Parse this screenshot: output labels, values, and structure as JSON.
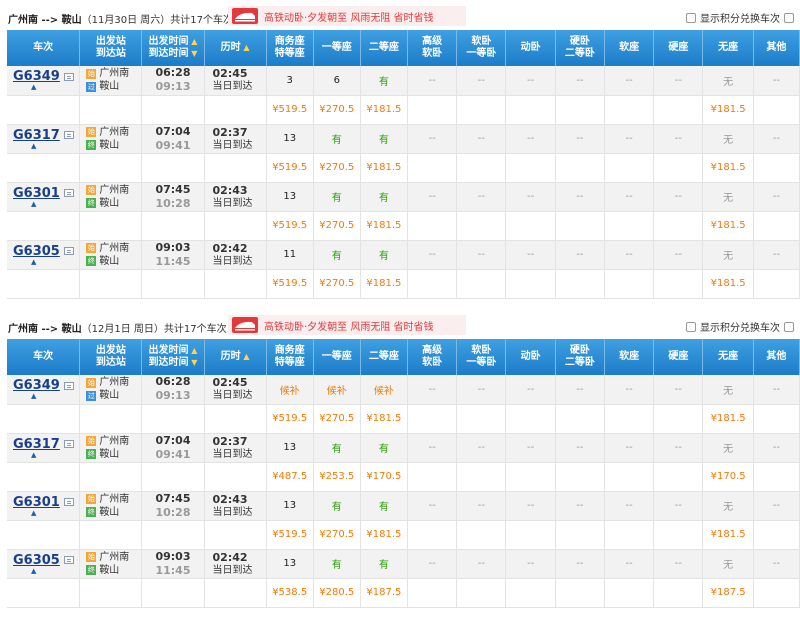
{
  "options_label": "显示积分兑换车次",
  "banner_text": "高铁动卧·夕发朝至 风雨无阻 省时省钱",
  "headers": [
    "车次",
    "出发站\n到达站",
    "出发时间\n到达时间",
    "历时",
    "商务座\n特等座",
    "一等座",
    "二等座",
    "高级\n软卧",
    "软卧\n一等卧",
    "动卧",
    "硬卧\n二等卧",
    "软座",
    "硬座",
    "无座",
    "其他"
  ],
  "colors": {
    "header_blue": "#1c7cc8",
    "price_orange": "#f07b0a",
    "available_green": "#26a306",
    "train_no_blue": "#1a3f8a",
    "banner_red": "#e4393c"
  },
  "sections": [
    {
      "route": "广州南 --> 鞍山",
      "date_text": "（11月30日 周六）",
      "count_text": "共计17个车次",
      "trains": [
        {
          "no": "G6349",
          "from": "广州南",
          "to": "鞍山",
          "from_badge": "始",
          "to_badge": "过",
          "dep": "06:28",
          "arr": "09:13",
          "dur": "02:45",
          "day": "当日到达",
          "seats": [
            "3",
            "6",
            "有",
            "--",
            "--",
            "--",
            "--",
            "--",
            "--",
            "无",
            "--"
          ],
          "prices": [
            "¥519.5",
            "¥270.5",
            "¥181.5",
            "",
            "",
            "",
            "",
            "",
            "",
            "¥181.5",
            ""
          ]
        },
        {
          "no": "G6317",
          "from": "广州南",
          "to": "鞍山",
          "from_badge": "始",
          "to_badge": "终",
          "dep": "07:04",
          "arr": "09:41",
          "dur": "02:37",
          "day": "当日到达",
          "seats": [
            "13",
            "有",
            "有",
            "--",
            "--",
            "--",
            "--",
            "--",
            "--",
            "无",
            "--"
          ],
          "prices": [
            "¥519.5",
            "¥270.5",
            "¥181.5",
            "",
            "",
            "",
            "",
            "",
            "",
            "¥181.5",
            ""
          ]
        },
        {
          "no": "G6301",
          "from": "广州南",
          "to": "鞍山",
          "from_badge": "始",
          "to_badge": "终",
          "dep": "07:45",
          "arr": "10:28",
          "dur": "02:43",
          "day": "当日到达",
          "seats": [
            "13",
            "有",
            "有",
            "--",
            "--",
            "--",
            "--",
            "--",
            "--",
            "无",
            "--"
          ],
          "prices": [
            "¥519.5",
            "¥270.5",
            "¥181.5",
            "",
            "",
            "",
            "",
            "",
            "",
            "¥181.5",
            ""
          ]
        },
        {
          "no": "G6305",
          "from": "广州南",
          "to": "鞍山",
          "from_badge": "始",
          "to_badge": "终",
          "dep": "09:03",
          "arr": "11:45",
          "dur": "02:42",
          "day": "当日到达",
          "seats": [
            "11",
            "有",
            "有",
            "--",
            "--",
            "--",
            "--",
            "--",
            "--",
            "无",
            "--"
          ],
          "prices": [
            "¥519.5",
            "¥270.5",
            "¥181.5",
            "",
            "",
            "",
            "",
            "",
            "",
            "¥181.5",
            ""
          ]
        }
      ]
    },
    {
      "route": "广州南 --> 鞍山",
      "date_text": "（12月1日 周日）",
      "count_text": "共计17个车次",
      "trains": [
        {
          "no": "G6349",
          "from": "广州南",
          "to": "鞍山",
          "from_badge": "始",
          "to_badge": "过",
          "dep": "06:28",
          "arr": "09:13",
          "dur": "02:45",
          "day": "当日到达",
          "seats": [
            "候补",
            "候补",
            "候补",
            "--",
            "--",
            "--",
            "--",
            "--",
            "--",
            "无",
            "--"
          ],
          "prices": [
            "¥519.5",
            "¥270.5",
            "¥181.5",
            "",
            "",
            "",
            "",
            "",
            "",
            "¥181.5",
            ""
          ]
        },
        {
          "no": "G6317",
          "from": "广州南",
          "to": "鞍山",
          "from_badge": "始",
          "to_badge": "终",
          "dep": "07:04",
          "arr": "09:41",
          "dur": "02:37",
          "day": "当日到达",
          "seats": [
            "13",
            "有",
            "有",
            "--",
            "--",
            "--",
            "--",
            "--",
            "--",
            "无",
            "--"
          ],
          "prices": [
            "¥487.5",
            "¥253.5",
            "¥170.5",
            "",
            "",
            "",
            "",
            "",
            "",
            "¥170.5",
            ""
          ]
        },
        {
          "no": "G6301",
          "from": "广州南",
          "to": "鞍山",
          "from_badge": "始",
          "to_badge": "终",
          "dep": "07:45",
          "arr": "10:28",
          "dur": "02:43",
          "day": "当日到达",
          "seats": [
            "13",
            "有",
            "有",
            "--",
            "--",
            "--",
            "--",
            "--",
            "--",
            "无",
            "--"
          ],
          "prices": [
            "¥519.5",
            "¥270.5",
            "¥181.5",
            "",
            "",
            "",
            "",
            "",
            "",
            "¥181.5",
            ""
          ]
        },
        {
          "no": "G6305",
          "from": "广州南",
          "to": "鞍山",
          "from_badge": "始",
          "to_badge": "终",
          "dep": "09:03",
          "arr": "11:45",
          "dur": "02:42",
          "day": "当日到达",
          "seats": [
            "13",
            "有",
            "有",
            "--",
            "--",
            "--",
            "--",
            "--",
            "--",
            "无",
            "--"
          ],
          "prices": [
            "¥538.5",
            "¥280.5",
            "¥187.5",
            "",
            "",
            "",
            "",
            "",
            "",
            "¥187.5",
            ""
          ]
        }
      ]
    }
  ]
}
